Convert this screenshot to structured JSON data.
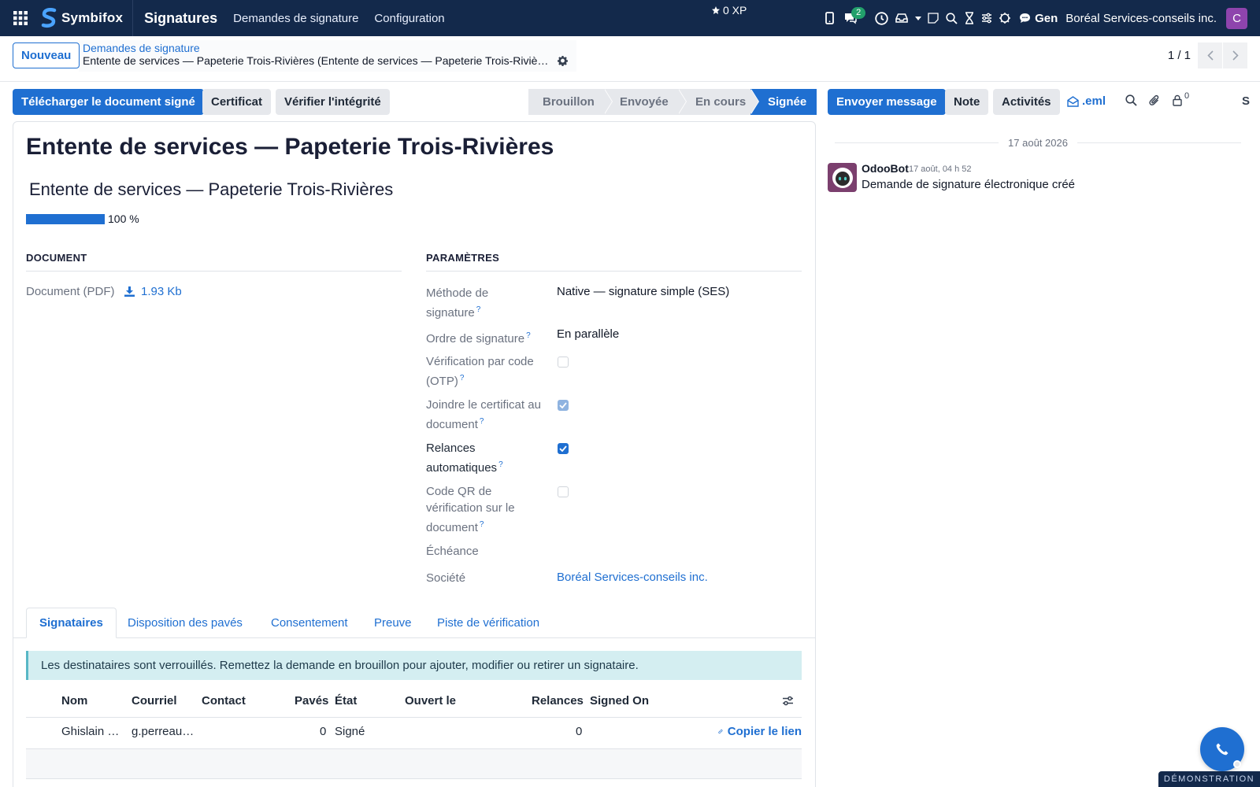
{
  "navbar": {
    "logo_text": "Symbifox",
    "app_title": "Signatures",
    "menus": [
      "Demandes de signature",
      "Configuration"
    ],
    "xp": "0 XP",
    "chat_count": "2",
    "gen_label": "Gen",
    "company": "Boréal Services-conseils inc.",
    "avatar_letter": "C"
  },
  "control": {
    "new_button": "Nouveau",
    "breadcrumb_parent": "Demandes de signature",
    "breadcrumb_current": "Entente de services — Papeterie Trois-Rivières (Entente de services — Papeterie Trois-Rivières)",
    "pager": "1 / 1"
  },
  "actions": {
    "download_signed": "Télécharger le document signé",
    "certificate": "Certificat",
    "verify_integrity": "Vérifier l'intégrité",
    "statuses": [
      "Brouillon",
      "Envoyée",
      "En cours",
      "Signée"
    ],
    "active_status": "Signée",
    "send_message": "Envoyer message",
    "note": "Note",
    "activities": "Activités",
    "eml": ".eml",
    "followers_count": "0",
    "truncated_label": "S"
  },
  "form": {
    "title": "Entente de services — Papeterie Trois-Rivières",
    "subtitle": "Entente de services — Papeterie Trois-Rivières",
    "progress_percent": 100,
    "progress_label": "100 %",
    "document_section": "DOCUMENT",
    "params_section": "PARAMÈTRES",
    "document_label": "Document (PDF)",
    "document_size": "1.93 Kb",
    "params": {
      "method_label": "Méthode de signature",
      "method_value": "Native — signature simple (SES)",
      "order_label": "Ordre de signature",
      "order_value": "En parallèle",
      "otp_label": "Vérification par code (OTP)",
      "otp_checked": false,
      "attach_cert_label": "Joindre le certificat au document",
      "attach_cert_checked": true,
      "reminders_label": "Relances automatiques",
      "reminders_checked": true,
      "qr_label": "Code QR de vérification sur le document",
      "qr_checked": false,
      "deadline_label": "Échéance",
      "company_label": "Société",
      "company_value": "Boréal Services-conseils inc."
    },
    "help_mark": "?"
  },
  "tabs": [
    "Signataires",
    "Disposition des pavés",
    "Consentement",
    "Preuve",
    "Piste de vérification"
  ],
  "active_tab": "Signataires",
  "alert": "Les destinataires sont verrouillés. Remettez la demande en brouillon pour ajouter, modifier ou retirer un signataire.",
  "table": {
    "headers": [
      "Nom",
      "Courriel",
      "Contact",
      "Pavés",
      "État",
      "Ouvert le",
      "Relances",
      "Signed On"
    ],
    "rows": [
      {
        "name": "Ghislain Perreault",
        "email": "g.perreault@papeterie-tr.ca",
        "contact": "",
        "fields": "0",
        "state": "Signé",
        "opened": "",
        "reminders": "0",
        "signed_on": "",
        "action": "Copier le lien"
      }
    ]
  },
  "chatter": {
    "date": "17 août 2026",
    "author": "OdooBot",
    "time": "17 août, 04 h 52",
    "body": "Demande de signature électronique créé"
  },
  "ribbon": "DÉMONSTRATION",
  "colors": {
    "navbar": "#13294b",
    "primary": "#1f6fd1",
    "secondary": "#e6e8ec",
    "alert_bg": "#d4eef1",
    "avatar": "#8e44ad"
  }
}
